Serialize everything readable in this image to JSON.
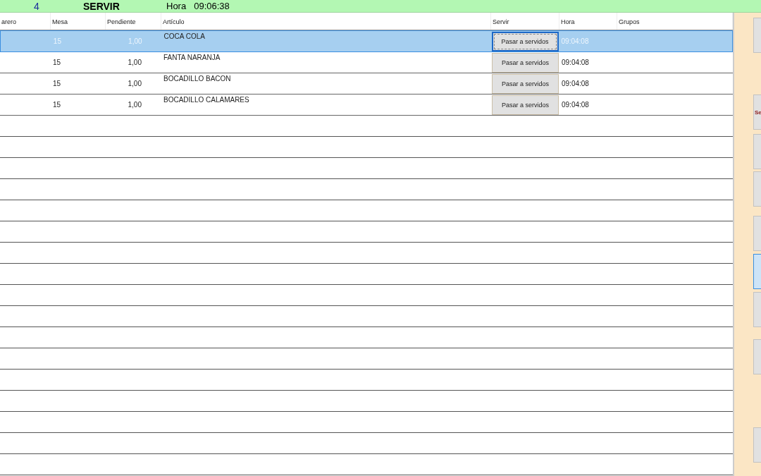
{
  "header": {
    "count": "4",
    "title": "SERVIR",
    "time_label": "Hora",
    "time": "09:06:38"
  },
  "table": {
    "columns": [
      "arero",
      "Mesa",
      "Pendiente",
      "Artículo",
      "Servir",
      "Hora",
      "Grupos"
    ],
    "rows": [
      {
        "selected": true,
        "mesa": "15",
        "pendiente": "1,00",
        "articulo": "COCA COLA",
        "action": "Pasar a servidos",
        "hora": "09:04:08"
      },
      {
        "selected": false,
        "mesa": "15",
        "pendiente": "1,00",
        "articulo": "FANTA NARANJA",
        "action": "Pasar a servidos",
        "hora": "09:04:08"
      },
      {
        "selected": false,
        "mesa": "15",
        "pendiente": "1,00",
        "articulo": "BOCADILLO BACON",
        "action": "Pasar a servidos",
        "hora": "09:04:08"
      },
      {
        "selected": false,
        "mesa": "15",
        "pendiente": "1,00",
        "articulo": "BOCADILLO CALAMARES",
        "action": "Pasar a servidos",
        "hora": "09:04:08"
      }
    ]
  },
  "side_buttons": [
    {
      "selected": false
    },
    {
      "selected": false,
      "label": "Se"
    },
    {
      "selected": false
    },
    {
      "selected": false
    },
    {
      "selected": false
    },
    {
      "selected": true
    },
    {
      "selected": false
    },
    {
      "selected": false
    },
    {
      "selected": false
    }
  ]
}
